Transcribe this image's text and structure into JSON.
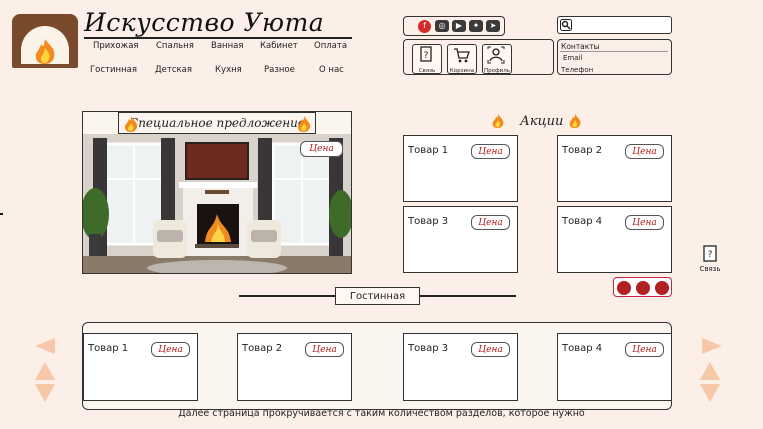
{
  "brand": {
    "title": "Искусство Уюта"
  },
  "nav": {
    "row1": [
      "Прихожая",
      "Спальня",
      "Ванная",
      "Кабинет",
      "Оплата"
    ],
    "row2": [
      "Гостинная",
      "Детская",
      "Кухня",
      "Разное",
      "О нас"
    ]
  },
  "header_icons": [
    {
      "label": "Связь",
      "icon": "help-icon"
    },
    {
      "label": "Корзина",
      "icon": "cart-icon"
    },
    {
      "label": "Профиль",
      "icon": "profile-icon"
    }
  ],
  "social": [
    "instagram",
    "youtube",
    "twitter",
    "telegram"
  ],
  "search": {
    "placeholder": ""
  },
  "contacts": {
    "title": "Контакты",
    "email": "Email",
    "phone": "Телефон"
  },
  "special": {
    "title": "Специальное предложение",
    "price": "Цена"
  },
  "promo": {
    "title": "Акции",
    "items": [
      {
        "name": "Товар 1",
        "price": "Цена"
      },
      {
        "name": "Товар 2",
        "price": "Цена"
      },
      {
        "name": "Товар 3",
        "price": "Цена"
      },
      {
        "name": "Товар 4",
        "price": "Цена"
      }
    ]
  },
  "side_contact": {
    "label": "Связь"
  },
  "section": {
    "title": "Гостинная",
    "items": [
      {
        "name": "Товар 1",
        "price": "Цена"
      },
      {
        "name": "Товар 2",
        "price": "Цена"
      },
      {
        "name": "Товар 3",
        "price": "Цена"
      },
      {
        "name": "Товар 4",
        "price": "Цена"
      }
    ]
  },
  "footer_note": "Далее страница прокручивается с таким количеством разделов, которое нужно",
  "colors": {
    "background": "#fcefe7",
    "accent": "#b02121",
    "arrow": "#f6c8a8",
    "logo": "#7a4a2c"
  }
}
